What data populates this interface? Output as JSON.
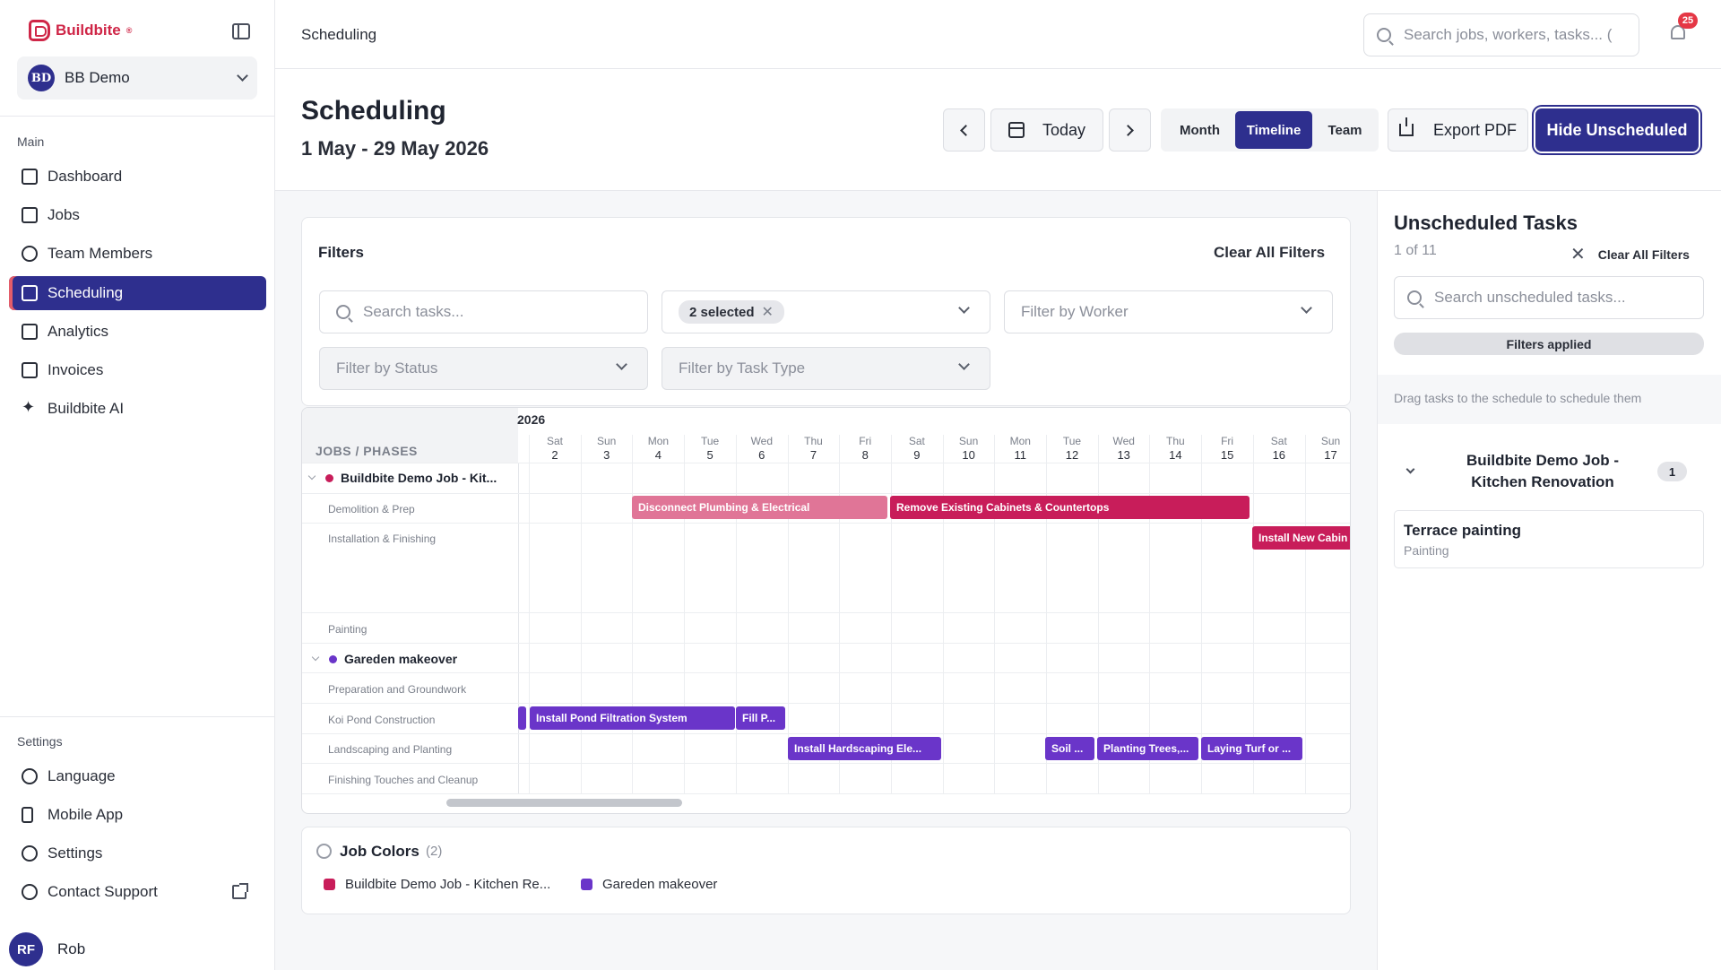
{
  "app": {
    "name": "Buildbite",
    "registered_mark": "®"
  },
  "sidebar": {
    "org": {
      "initials": "BD",
      "name": "BB Demo"
    },
    "main_label": "Main",
    "main_items": [
      {
        "label": "Dashboard",
        "icon": "dashboard-icon"
      },
      {
        "label": "Jobs",
        "icon": "jobs-icon"
      },
      {
        "label": "Team Members",
        "icon": "team-icon"
      },
      {
        "label": "Scheduling",
        "icon": "calendar-icon",
        "active": true
      },
      {
        "label": "Analytics",
        "icon": "chart-icon"
      },
      {
        "label": "Invoices",
        "icon": "invoice-icon"
      },
      {
        "label": "Buildbite AI",
        "icon": "sparkle-icon"
      }
    ],
    "settings_label": "Settings",
    "settings_items": [
      {
        "label": "Language",
        "icon": "globe-icon"
      },
      {
        "label": "Mobile App",
        "icon": "phone-icon"
      },
      {
        "label": "Settings",
        "icon": "gear-icon"
      },
      {
        "label": "Contact Support",
        "icon": "help-icon"
      }
    ],
    "user": {
      "initials": "RF",
      "name": "Rob"
    }
  },
  "topbar": {
    "breadcrumb": "Scheduling",
    "search_placeholder": "Search jobs, workers, tasks... (",
    "notification_count": "25"
  },
  "header": {
    "title": "Scheduling",
    "range": "1 May - 29 May 2026",
    "today_label": "Today",
    "views": [
      "Month",
      "Timeline",
      "Team"
    ],
    "active_view": "Timeline",
    "export_label": "Export PDF",
    "hide_label": "Hide Unscheduled"
  },
  "filters": {
    "title": "Filters",
    "clear_label": "Clear All Filters",
    "search_placeholder": "Search tasks...",
    "jobs_chip": "2 selected",
    "worker_placeholder": "Filter by Worker",
    "status_placeholder": "Filter by Status",
    "task_type_placeholder": "Filter by Task Type"
  },
  "timeline": {
    "year": "2026",
    "left_header": "JOBS / PHASES",
    "days": [
      {
        "dow": "Sat",
        "d": "2"
      },
      {
        "dow": "Sun",
        "d": "3"
      },
      {
        "dow": "Mon",
        "d": "4"
      },
      {
        "dow": "Tue",
        "d": "5"
      },
      {
        "dow": "Wed",
        "d": "6"
      },
      {
        "dow": "Thu",
        "d": "7"
      },
      {
        "dow": "Fri",
        "d": "8"
      },
      {
        "dow": "Sat",
        "d": "9"
      },
      {
        "dow": "Sun",
        "d": "10"
      },
      {
        "dow": "Mon",
        "d": "11"
      },
      {
        "dow": "Tue",
        "d": "12"
      },
      {
        "dow": "Wed",
        "d": "13"
      },
      {
        "dow": "Thu",
        "d": "14"
      },
      {
        "dow": "Fri",
        "d": "15"
      },
      {
        "dow": "Sat",
        "d": "16"
      },
      {
        "dow": "Sun",
        "d": "17"
      }
    ],
    "jobs": [
      {
        "name": "Buildbite Demo Job - Kit...",
        "color": "#c81d5a",
        "phases": [
          "Demolition & Prep",
          "Installation & Finishing",
          "Painting"
        ]
      },
      {
        "name": "Gareden makeover",
        "color": "#6a35c9",
        "phases": [
          "Preparation and Groundwork",
          "Koi Pond Construction",
          "Landscaping and Planting",
          "Finishing Touches and Cleanup"
        ]
      }
    ],
    "tasks": [
      {
        "label": "Disconnect Plumbing & Electrical",
        "color": "#e07597"
      },
      {
        "label": "Remove Existing Cabinets & Countertops",
        "color": "#c81d5a"
      },
      {
        "label": "Install New Cabin",
        "color": "#c81d5a"
      },
      {
        "label": "",
        "color": "#6a35c9"
      },
      {
        "label": "Install Pond Filtration System",
        "color": "#6a35c9"
      },
      {
        "label": "Fill P...",
        "color": "#6a35c9"
      },
      {
        "label": "Install Hardscaping Ele...",
        "color": "#6a35c9"
      },
      {
        "label": "Soil ...",
        "color": "#6a35c9"
      },
      {
        "label": "Planting Trees,...",
        "color": "#6a35c9"
      },
      {
        "label": "Laying Turf or ...",
        "color": "#6a35c9"
      }
    ]
  },
  "job_colors": {
    "title": "Job Colors",
    "count": "(2)",
    "items": [
      {
        "label": "Buildbite Demo Job - Kitchen Re...",
        "color": "#c81d5a"
      },
      {
        "label": "Gareden makeover",
        "color": "#6a35c9"
      }
    ]
  },
  "unscheduled": {
    "title": "Unscheduled Tasks",
    "count": "1 of 11",
    "clear_label": "Clear All Filters",
    "search_placeholder": "Search unscheduled tasks...",
    "filters_applied": "Filters applied",
    "hint": "Drag tasks to the schedule to schedule them",
    "group_name": "Buildbite Demo Job - Kitchen Renovation",
    "group_count": "1",
    "task_name": "Terrace painting",
    "task_type": "Painting"
  }
}
